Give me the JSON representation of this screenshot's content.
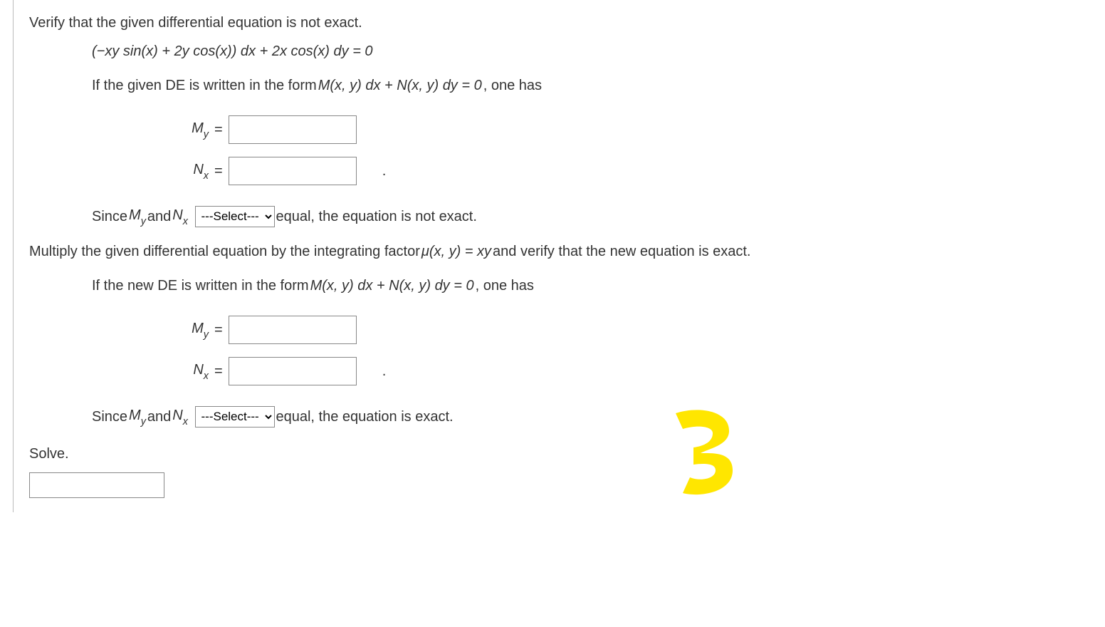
{
  "intro": "Verify that the given differential equation is not exact.",
  "equation": "(−xy sin(x) + 2y cos(x)) dx + 2x cos(x) dy = 0",
  "form_intro_1": "If the given DE is written in the form ",
  "form_expr_1": "M(x, y) dx + N(x, y) dy = 0",
  "form_tail_1": ", one has",
  "labels": {
    "My": "M",
    "My_sub": "y",
    "Nx": "N",
    "Nx_sub": "x",
    "equals": " = "
  },
  "since_prefix": "Since ",
  "since_and": " and ",
  "since_tail_notexact": " equal, the equation is not exact.",
  "select_placeholder": "---Select---",
  "multiply_line_1": "Multiply the given differential equation by the integrating factor ",
  "mu_expr": "μ(x, y) = xy",
  "multiply_line_2": " and verify that the new equation is exact.",
  "form_intro_2": "If the new DE is written in the form ",
  "form_expr_2": "M(x, y) dx + N(x, y) dy = 0",
  "form_tail_2": ", one has",
  "since_tail_exact": " equal, the equation is exact.",
  "solve": "Solve.",
  "period": "."
}
